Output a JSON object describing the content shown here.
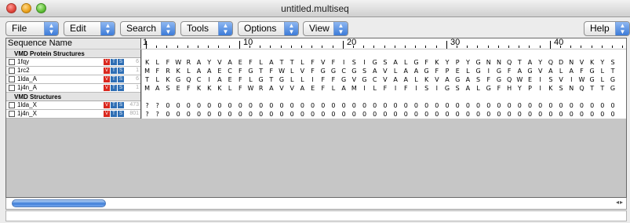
{
  "window": {
    "title": "untitled.multiseq"
  },
  "menus": [
    {
      "label": "File"
    },
    {
      "label": "Edit"
    },
    {
      "label": "Search"
    },
    {
      "label": "Tools"
    },
    {
      "label": "Options"
    },
    {
      "label": "View"
    },
    {
      "label": "Help"
    }
  ],
  "header": {
    "sequence_name": "Sequence Name",
    "ruler_labels": [
      "1",
      "10",
      "20",
      "30",
      "40"
    ]
  },
  "groups": [
    {
      "title": "VMD Protein Structures",
      "rows": [
        {
          "name": "1fqy",
          "number": "6",
          "sequence": "KLFWRAYVAEFLATTLFVFISIGSALGFKYPYGNNQTAYQDNVKYS"
        },
        {
          "name": "1rc2",
          "number": "1",
          "sequence": "MFRKLAAECFGTFWLVFGGCGSAVLAAGFPELGIGFAGVALAFGLT"
        },
        {
          "name": "1lda_A",
          "number": "6",
          "sequence": "TLKGQCIAEFLGTGLLIFFGVGCVAALKVAGASFGQWEISVIWGLG"
        },
        {
          "name": "1j4n_A",
          "number": "1",
          "sequence": "MASEFKKKLFWRAVVAEFLAMILFIFISIGSALGFHYPIKSNQTTG"
        }
      ]
    },
    {
      "title": "VMD Structures",
      "rows": [
        {
          "name": "1lda_X",
          "number": "473",
          "sequence": "??00000000000000000000000000000000000000000000"
        },
        {
          "name": "1j4n_X",
          "number": "801",
          "sequence": "??00000000000000000000000000000000000000000000"
        }
      ]
    }
  ],
  "row_icons": [
    "V",
    "T",
    "S"
  ],
  "colors": {
    "accent_blue": "#3d7bd8",
    "icon_red": "#d9281f",
    "icon_blue": "#2f6fb5"
  }
}
